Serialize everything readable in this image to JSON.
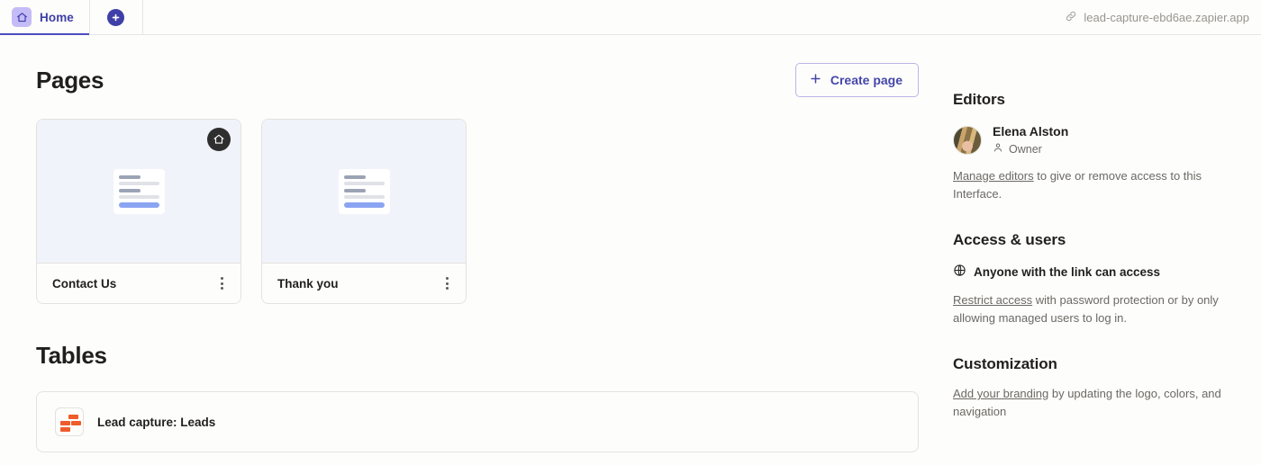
{
  "topbar": {
    "tabs": [
      {
        "label": "Home",
        "icon": "home-icon",
        "active": true
      }
    ],
    "add_tab_icon": "plus-circle-icon",
    "url": "lead-capture-ebd6ae.zapier.app",
    "url_icon": "link-icon"
  },
  "main": {
    "pages_section": {
      "title": "Pages",
      "create_button": {
        "label": "Create page",
        "icon": "plus-icon"
      },
      "cards": [
        {
          "title": "Contact Us",
          "is_home": true,
          "home_badge_icon": "home-icon",
          "menu_icon": "kebab-menu-icon"
        },
        {
          "title": "Thank you",
          "is_home": false,
          "menu_icon": "kebab-menu-icon"
        }
      ]
    },
    "tables_section": {
      "title": "Tables",
      "rows": [
        {
          "name": "Lead capture: Leads",
          "icon": "zapier-tables-icon"
        }
      ]
    }
  },
  "sidebar": {
    "editors": {
      "title": "Editors",
      "person": {
        "name": "Elena Alston",
        "role": "Owner",
        "role_icon": "person-icon",
        "avatar": "user-avatar"
      },
      "note_link": "Manage editors",
      "note_rest": " to give or remove access to this Interface."
    },
    "access": {
      "title": "Access & users",
      "status_icon": "globe-icon",
      "status": "Anyone with the link can access",
      "note_link": "Restrict access",
      "note_rest": " with password protection or by only allowing managed users to log in."
    },
    "customization": {
      "title": "Customization",
      "note_link": "Add your branding",
      "note_rest": " by updating the logo, colors, and navigation"
    }
  },
  "colors": {
    "accent": "#3f3fa8",
    "tab_icon_bg": "#c4bcf7",
    "table_icon": "#ef5b2b",
    "page_bg": "#fdfdfb",
    "card_preview_bg": "#f1f3fa"
  }
}
